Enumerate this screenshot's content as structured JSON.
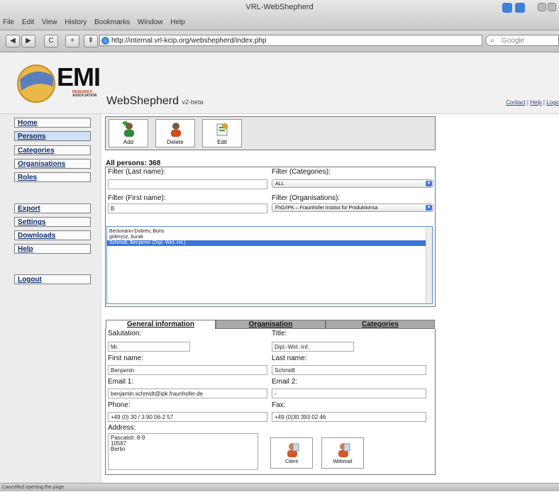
{
  "window": {
    "title": "VRL-WebShepherd"
  },
  "menu": [
    "File",
    "Edit",
    "View",
    "History",
    "Bookmarks",
    "Window",
    "Help"
  ],
  "navbar": {
    "url": "http://internal.vrl-kcip.org/webshepherd/index.php",
    "search_placeholder": "Google",
    "back": "◀",
    "forward": "▶",
    "reload": "C",
    "add": "+",
    "home": "⇞"
  },
  "header": {
    "logo_text": "EMI",
    "logo_sub": [
      "RESEARCH",
      "ASSOCIATION"
    ],
    "app_title": "WebShepherd",
    "app_version": "v2-beta",
    "links": [
      "Contact",
      "Help",
      "Logo"
    ]
  },
  "sidebar": {
    "items": [
      {
        "label": "Home"
      },
      {
        "label": "Persons"
      },
      {
        "label": "Categories"
      },
      {
        "label": "Organisations"
      },
      {
        "label": "Roles"
      },
      {
        "label": "Export"
      },
      {
        "label": "Settings"
      },
      {
        "label": "Downloads"
      },
      {
        "label": "Help"
      },
      {
        "label": "Logout"
      }
    ]
  },
  "toolbar": {
    "add": "Add",
    "delete": "Delete",
    "edit": "Edit"
  },
  "persons": {
    "count_label": "All persons: 368",
    "filter_last_label": "Filter (Last name):",
    "filter_last_value": "",
    "filter_first_label": "Filter (First name):",
    "filter_first_value": "B",
    "filter_cat_label": "Filter (Categories):",
    "filter_cat_value": "ALL",
    "filter_org_label": "Filter (Organisations):",
    "filter_org_value": "FhG/IPK – Fraunhofer Institut für Produktionsa",
    "list": [
      "Beckmann-Dobrev, Boris",
      "güleryüz, burak",
      "Schmidt, Benjamin (Dipl.-Wirt.-Inf.)"
    ]
  },
  "tabs": [
    "General information",
    "Organisation",
    "Categories"
  ],
  "detail": {
    "salutation_label": "Salutation:",
    "salutation": "Mr.",
    "title_label": "Title:",
    "title": "Dipl.-Wirt.-Inf.",
    "first_label": "First name:",
    "first": "Benjamin",
    "last_label": "Last name:",
    "last": "Schmidt",
    "email1_label": "Email 1:",
    "email1": "benjamin.schmidt@ipk.fraunhofer.de",
    "email2_label": "Email 2:",
    "email2": "-",
    "phone_label": "Phone:",
    "phone": "+49 (0) 30 / 3 90 06-2 57",
    "fax_label": "Fax:",
    "fax": "+49 (0)30 393 02 46",
    "address_label": "Address:",
    "address": [
      "Pascalstr. 8-9",
      "10587",
      "Berlin"
    ],
    "client_btn": "Client",
    "webmail_btn": "Webmail"
  },
  "status": "Cancelled opening the page"
}
